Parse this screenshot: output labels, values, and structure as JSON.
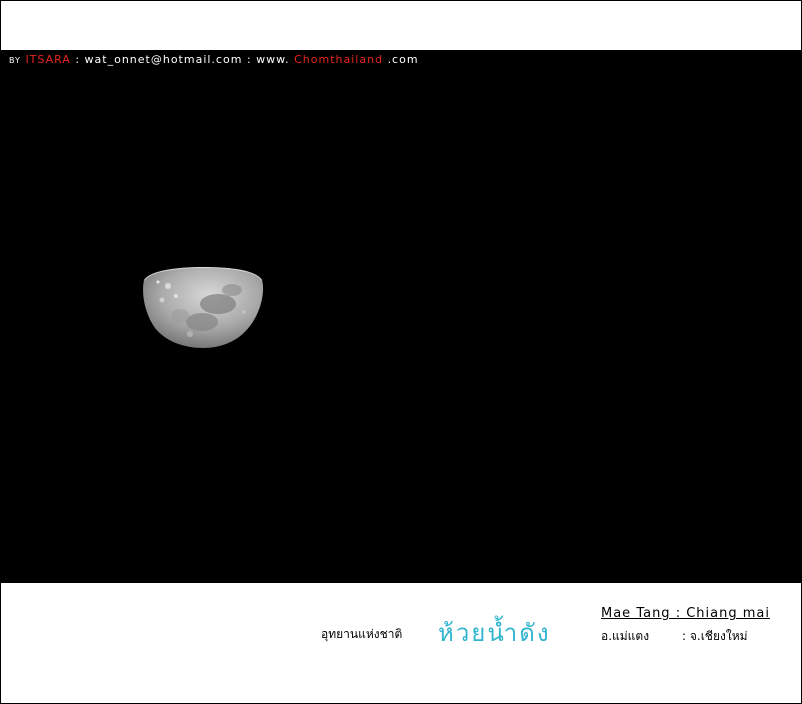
{
  "credit": {
    "by": "BY",
    "author": "ITSARA",
    "sep1": " : ",
    "email": "wat_onnet@hotmail.com",
    "sep2": " : ",
    "site_prefix": "www.",
    "site_brand": "Chomthailand",
    "site_suffix": ".com"
  },
  "caption": {
    "park_label": "อุทยานแห่งชาติ",
    "park_name": "ห้วยน้ำดัง",
    "location_en": "Mae Tang : Chiang mai",
    "district_th": "อ.แม่แตง",
    "province_th": ": จ.เชียงใหม่"
  },
  "colors": {
    "background": "#000000",
    "accent_red": "#e8261d",
    "accent_cyan": "#31b5cf"
  }
}
